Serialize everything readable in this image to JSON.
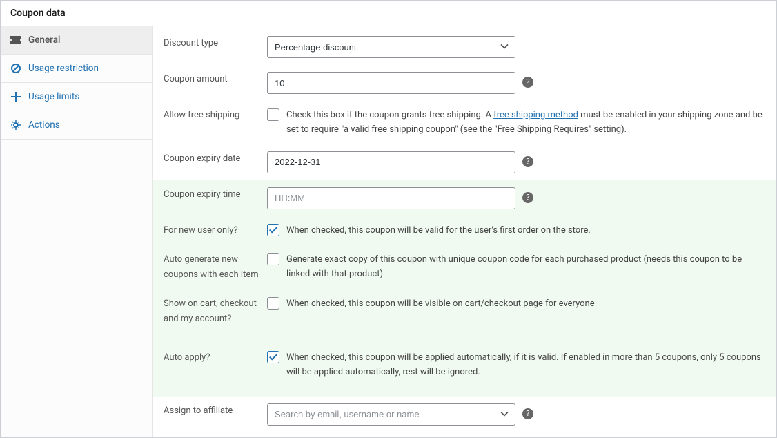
{
  "header": {
    "title": "Coupon data"
  },
  "tabs": {
    "general": "General",
    "usage_restriction": "Usage restriction",
    "usage_limits": "Usage limits",
    "actions": "Actions"
  },
  "fields": {
    "discount_type": {
      "label": "Discount type",
      "selected": "Percentage discount"
    },
    "coupon_amount": {
      "label": "Coupon amount",
      "value": "10"
    },
    "allow_free_shipping": {
      "label": "Allow free shipping",
      "text_before": "Check this box if the coupon grants free shipping. A ",
      "link_text": "free shipping method",
      "text_after": " must be enabled in your shipping zone and be set to require \"a valid free shipping coupon\" (see the \"Free Shipping Requires\" setting)."
    },
    "expiry_date": {
      "label": "Coupon expiry date",
      "value": "2022-12-31"
    },
    "expiry_time": {
      "label": "Coupon expiry time",
      "placeholder": "HH:MM"
    },
    "new_user": {
      "label": "For new user only?",
      "text": "When checked, this coupon will be valid for the user's first order on the store."
    },
    "auto_generate": {
      "label": "Auto generate new coupons with each item",
      "text": "Generate exact copy of this coupon with unique coupon code for each purchased product (needs this coupon to be linked with that product)"
    },
    "show_on_cart": {
      "label": "Show on cart, checkout and my account?",
      "text": "When checked, this coupon will be visible on cart/checkout page for everyone"
    },
    "auto_apply": {
      "label": "Auto apply?",
      "text": "When checked, this coupon will be applied automatically, if it is valid. If enabled in more than 5 coupons, only 5 coupons will be applied automatically, rest will be ignored."
    },
    "assign_affiliate": {
      "label": "Assign to affiliate",
      "placeholder": "Search by email, username or name"
    }
  }
}
